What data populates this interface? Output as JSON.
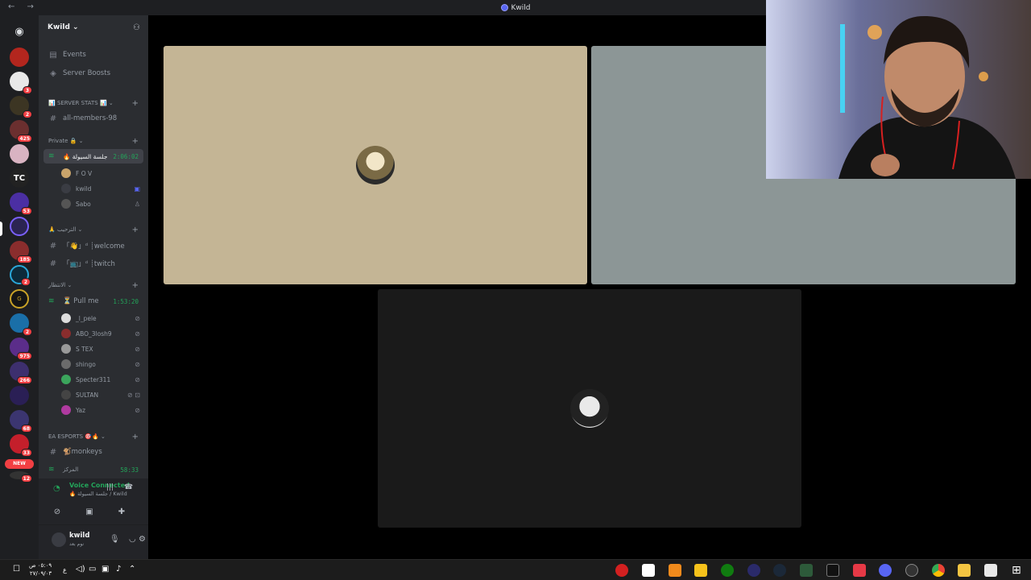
{
  "window": {
    "title": "Kwild",
    "nav": "← →"
  },
  "server": {
    "name": "Kwild ⌄"
  },
  "guild_badges": [
    "3",
    "2",
    "425",
    "53",
    "2",
    "185",
    "2",
    "975",
    "266",
    "68",
    "33",
    "12"
  ],
  "new_badge": "NEW",
  "top_items": [
    {
      "label": "Events"
    },
    {
      "label": "Server Boosts"
    }
  ],
  "categories": {
    "server_stats": "📊 SERVER STATS 📊 ⌄",
    "private": "Private 🔒 ⌄",
    "welcome": "🙏 الترحيب ⌄",
    "waiting": "الانتظار ⌄",
    "ea": "EA ESPORTS 🎯🔥 ⌄"
  },
  "channels": {
    "all_members": "all-members-98",
    "voice_session": "🔥 جلسة السيولة",
    "voice_session_time": "2:06:02",
    "welcome": "「👋」ᵈ ┊welcome",
    "twitch": "「📺」ᵈ ┊twitch",
    "pull_me": "⏳ Pull me",
    "pull_me_time": "1:53:20",
    "monkeys": "🐒monkeys",
    "markaz": "المركز",
    "markaz_time": "58:33"
  },
  "session_members": [
    {
      "name": "F O V"
    },
    {
      "name": "kwild"
    },
    {
      "name": "Sabo"
    }
  ],
  "pull_members": [
    {
      "name": "_l_pele"
    },
    {
      "name": "ABO_3losh9"
    },
    {
      "name": "S TEX"
    },
    {
      "name": "shingo"
    },
    {
      "name": "Specter311"
    },
    {
      "name": "SULTAN"
    },
    {
      "name": "Yaz"
    }
  ],
  "voice_panel": {
    "status": "Voice Connected",
    "location": "🔥 جلسة السيولة / Kwild"
  },
  "user": {
    "name": "kwild",
    "status": "نوم بعد"
  },
  "taskbar": {
    "time": "٠٥:٠٩ ص",
    "date": "٢٧/٠٩/٠٣",
    "lang": "ع"
  },
  "colors": {
    "tile1": "#c4b595",
    "tile2": "#8c9696",
    "tile3": "#1a1a1a",
    "voice_green": "#23a55a",
    "blurple": "#5865f2"
  }
}
